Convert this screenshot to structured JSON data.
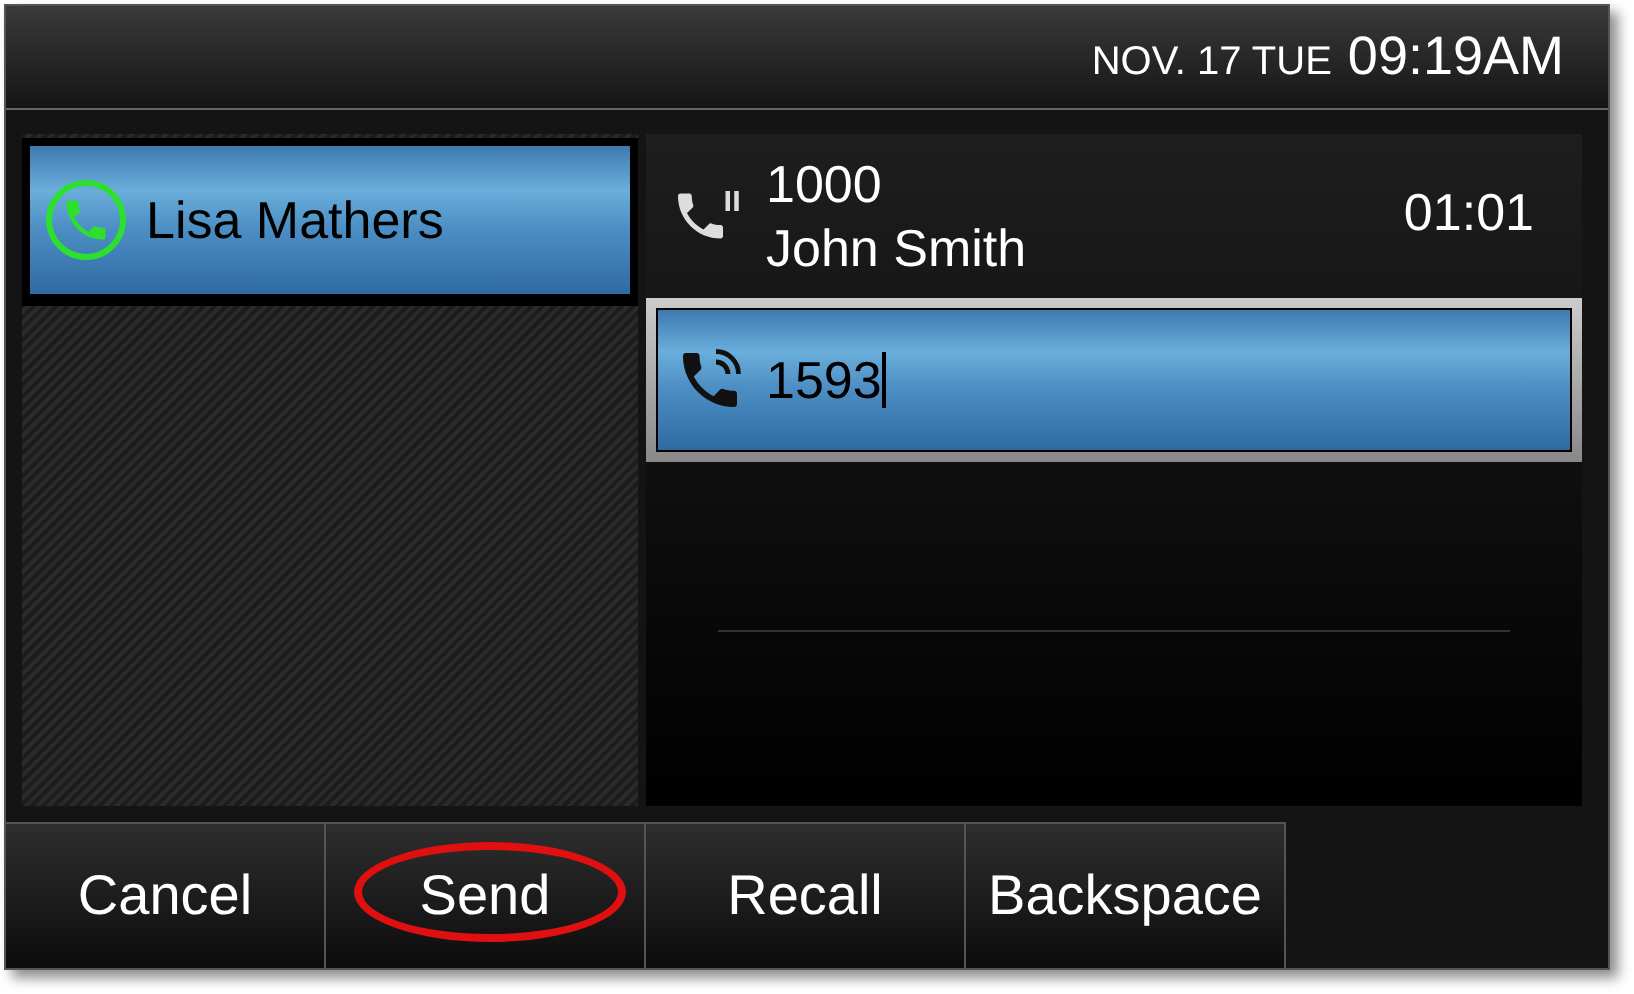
{
  "status_bar": {
    "date": "NOV. 17 TUE",
    "time": "09:19AM"
  },
  "lines": [
    {
      "label": "Lisa Mathers",
      "selected": true
    }
  ],
  "calls": [
    {
      "kind": "held",
      "number": "1000",
      "name": "John Smith",
      "duration": "01:01",
      "selected": false
    },
    {
      "kind": "dialing",
      "number": "1593",
      "selected": true
    }
  ],
  "softkeys": [
    {
      "label": "Cancel",
      "highlighted": false
    },
    {
      "label": "Send",
      "highlighted": true
    },
    {
      "label": "Recall",
      "highlighted": false
    },
    {
      "label": "Backspace",
      "highlighted": false
    }
  ]
}
